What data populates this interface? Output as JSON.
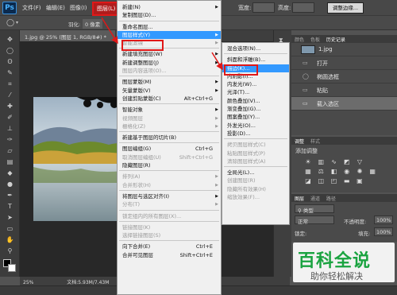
{
  "app": {
    "logo": "Ps"
  },
  "menubar": {
    "items": [
      "文件(F)",
      "编辑(E)",
      "图像(I)",
      "图层(L)"
    ],
    "right_labels": [
      "宽度:",
      "高度:",
      "调整边缘..."
    ]
  },
  "document": {
    "tab_title": "1.jpg @ 25% (图层 1, RGB/8#) *",
    "zoom": "25%",
    "doc_size": "文档:5.93M/7.43M"
  },
  "options": {
    "feather_label": "羽化:",
    "feather_value": "0 像素"
  },
  "layer_menu": {
    "items": [
      {
        "label": "新建(N)",
        "sub": true
      },
      {
        "label": "复制图层(D)...",
        "sub": false
      },
      {
        "sep": true
      },
      {
        "label": "重命名图层...",
        "sub": false
      },
      {
        "label": "图层样式(Y)",
        "sub": true,
        "highlight": true
      },
      {
        "label": "智能滤镜",
        "sub": true,
        "disabled": true
      },
      {
        "sep": true
      },
      {
        "label": "新建填充图层(W)",
        "sub": true
      },
      {
        "label": "新建调整图层(J)",
        "sub": true
      },
      {
        "label": "图层内容选项(O)...",
        "disabled": true
      },
      {
        "sep": true
      },
      {
        "label": "图层蒙版(M)",
        "sub": true
      },
      {
        "label": "矢量蒙版(V)",
        "sub": true
      },
      {
        "label": "创建剪贴蒙版(C)",
        "shortcut": "Alt+Ctrl+G"
      },
      {
        "sep": true
      },
      {
        "label": "智能对象",
        "sub": true
      },
      {
        "label": "视频图层",
        "sub": true,
        "disabled": true
      },
      {
        "label": "栅格化(Z)",
        "sub": true,
        "disabled": true
      },
      {
        "sep": true
      },
      {
        "label": "新建基于图层的切片(B)"
      },
      {
        "sep": true
      },
      {
        "label": "图层编组(G)",
        "shortcut": "Ctrl+G"
      },
      {
        "label": "取消图层编组(U)",
        "shortcut": "Shift+Ctrl+G",
        "disabled": true
      },
      {
        "label": "隐藏图层(R)"
      },
      {
        "sep": true
      },
      {
        "label": "排列(A)",
        "sub": true,
        "disabled": true
      },
      {
        "label": "合并形状(H)",
        "sub": true,
        "disabled": true
      },
      {
        "sep": true
      },
      {
        "label": "将图层与选区对齐(I)",
        "sub": true
      },
      {
        "label": "分布(T)",
        "sub": true,
        "disabled": true
      },
      {
        "sep": true
      },
      {
        "label": "锁定组内的所有图层(X)...",
        "disabled": true
      },
      {
        "sep": true
      },
      {
        "label": "链接图层(K)",
        "disabled": true
      },
      {
        "label": "选择链接图层(S)",
        "disabled": true
      },
      {
        "sep": true
      },
      {
        "label": "向下合并(E)",
        "shortcut": "Ctrl+E"
      },
      {
        "label": "合并可见图层",
        "shortcut": "Shift+Ctrl+E"
      }
    ]
  },
  "style_submenu": {
    "items": [
      {
        "label": "混合选项(N)..."
      },
      {
        "sep": true
      },
      {
        "label": "斜面和浮雕(B)..."
      },
      {
        "label": "描边(K)...",
        "highlight": true
      },
      {
        "label": "内阴影(I)..."
      },
      {
        "label": "内发光(W)..."
      },
      {
        "label": "光泽(T)..."
      },
      {
        "label": "颜色叠加(V)..."
      },
      {
        "label": "渐变叠加(G)..."
      },
      {
        "label": "图案叠加(Y)..."
      },
      {
        "label": "外发光(O)..."
      },
      {
        "label": "投影(D)..."
      },
      {
        "sep": true
      },
      {
        "label": "拷贝图层样式(C)",
        "disabled": true
      },
      {
        "label": "粘贴图层样式(P)",
        "disabled": true
      },
      {
        "label": "清除图层样式(A)",
        "disabled": true
      },
      {
        "sep": true
      },
      {
        "label": "全局光(L)..."
      },
      {
        "label": "创建图层(R)",
        "disabled": true
      },
      {
        "label": "隐藏所有效果(H)",
        "disabled": true
      },
      {
        "label": "缩放效果(F)...",
        "disabled": true
      }
    ]
  },
  "history_panel": {
    "tabs": [
      "颜色",
      "色板",
      "历史记录"
    ],
    "snapshot": "1.jpg",
    "items": [
      "打开",
      "椭圆选框",
      "粘贴",
      "载入选区"
    ]
  },
  "adjust_panel": {
    "tabs": [
      "调整",
      "样式"
    ],
    "title": "添加调整"
  },
  "layers_panel": {
    "tabs": [
      "图层",
      "通道",
      "路径"
    ],
    "kind_label": "类型",
    "blend_mode": "正常",
    "opacity_label": "不透明度:",
    "opacity_value": "100%",
    "lock_label": "锁定:",
    "fill_label": "填充:",
    "fill_value": "100%"
  },
  "watermark": {
    "title": "百科全说",
    "subtitle": "助你轻松解决"
  }
}
